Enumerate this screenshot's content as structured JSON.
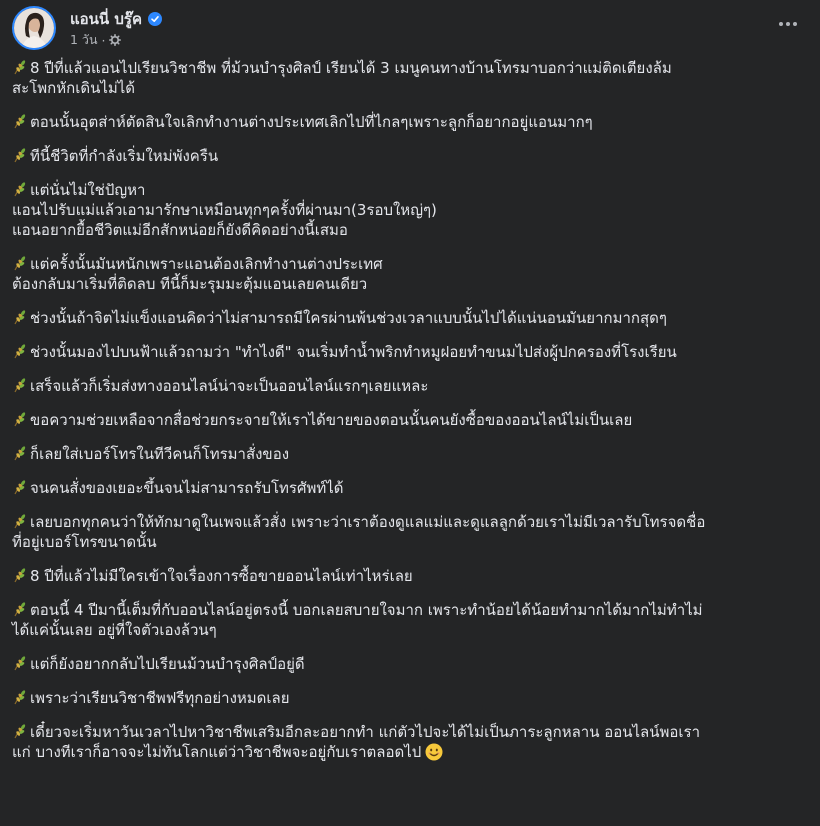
{
  "author": {
    "name": "แอนนี่ บรู๊ค",
    "verified_icon": "verified-badge-icon",
    "time": "1 วัน",
    "audience_icon": "public-gear-icon"
  },
  "post": {
    "paragraph_icon": "wheat-leaf-icon",
    "paragraphs": [
      [
        "8 ปีที่แล้วแอนไปเรียนวิชาชีพ ที่ม้วนบำรุงศิลป์ เรียนได้ 3 เมนูคนทางบ้านโทรมาบอกว่าแม่ติดเตียงล้ม",
        "สะโพกหักเดินไม่ได้"
      ],
      [
        "ตอนนั้นอุตส่าห์ตัดสินใจเลิกทำงานต่างประเทศเลิกไปที่ไกลๆเพราะลูกก็อยากอยู่แอนมากๆ"
      ],
      [
        "ทีนี้ชีวิตที่กำลังเริ่มใหม่พังครืน"
      ],
      [
        "แต่นั่นไม่ใช่ปัญหา",
        "แอนไปรับแม่แล้วเอามารักษาเหมือนทุกๆครั้งที่ผ่านมา(3รอบใหญ่ๆ)",
        "แอนอยากยื้อชีวิตแม่อีกสักหน่อยก็ยังดีคิดอย่างนี้เสมอ"
      ],
      [
        "แต่ครั้งนั้นมันหนักเพราะแอนต้องเลิกทำงานต่างประเทศ",
        "ต้องกลับมาเริ่มที่ติดลบ ทีนี้ก็มะรุมมะตุ้มแอนเลยคนเดียว"
      ],
      [
        "ช่วงนั้นถ้าจิตไม่แข็งแอนคิดว่าไม่สามารถมีใครผ่านพ้นช่วงเวลาแบบนั้นไปได้แน่นอนมันยากมากสุดๆ"
      ],
      [
        "ช่วงนั้นมองไปบนฟ้าแล้วถามว่า \"ทำไงดี\" จนเริ่มทำน้ำพริกทำหมูฝอยทำขนมไปส่งผู้ปกครองที่โรงเรียน"
      ],
      [
        "เสร็จแล้วก็เริ่มส่งทางออนไลน์น่าจะเป็นออนไลน์แรกๆเลยแหละ"
      ],
      [
        "ขอความช่วยเหลือจากสื่อช่วยกระจายให้เราได้ขายของตอนนั้นคนยังซื้อของออนไลน์ไม่เป็นเลย"
      ],
      [
        "ก็เลยใส่เบอร์โทรในทีวีคนก็โทรมาสั่งของ"
      ],
      [
        "จนคนสั่งของเยอะขึ้นจนไม่สามารถรับโทรศัพท์ได้"
      ],
      [
        "เลยบอกทุกคนว่าให้ทักมาดูในเพจแล้วสั่ง เพราะว่าเราต้องดูแลแม่และดูแลลูกด้วยเราไม่มีเวลารับโทรจดชื่อ",
        "ที่อยู่เบอร์โทรขนาดนั้น"
      ],
      [
        "8 ปีที่แล้วไม่มีใครเข้าใจเรื่องการซื้อขายออนไลน์เท่าไหร่เลย"
      ],
      [
        "ตอนนี้ 4 ปีมานี้เต็มที่กับออนไลน์อยู่ตรงนี้ บอกเลยสบายใจมาก เพราะทำน้อยได้น้อยทำมากได้มากไม่ทำไม่",
        "ได้แค่นั้นเลย อยู่ที่ใจตัวเองล้วนๆ"
      ],
      [
        "แต่ก็ยังอยากกลับไปเรียนม้วนบำรุงศิลป์อยู่ดี"
      ],
      [
        "เพราะว่าเรียนวิชาชีพฟรีทุกอย่างหมดเลย"
      ],
      [
        "เดี๋ยวจะเริ่มหาวันเวลาไปหาวิชาชีพเสริมอีกละอยากทำ แก่ตัวไปจะได้ไม่เป็นภาระลูกหลาน ออนไลน์พอเรา",
        "แก่ บางทีเราก็อาจจะไม่ทันโลกแต่ว่าวิชาชีพจะอยู่กับเราตลอดไป"
      ]
    ],
    "end_icon": "smiling-face-emoji-icon"
  },
  "colors": {
    "background": "#242526",
    "text": "#e4e6eb",
    "secondary_text": "#b0b3b8",
    "accent": "#2d88ff"
  }
}
